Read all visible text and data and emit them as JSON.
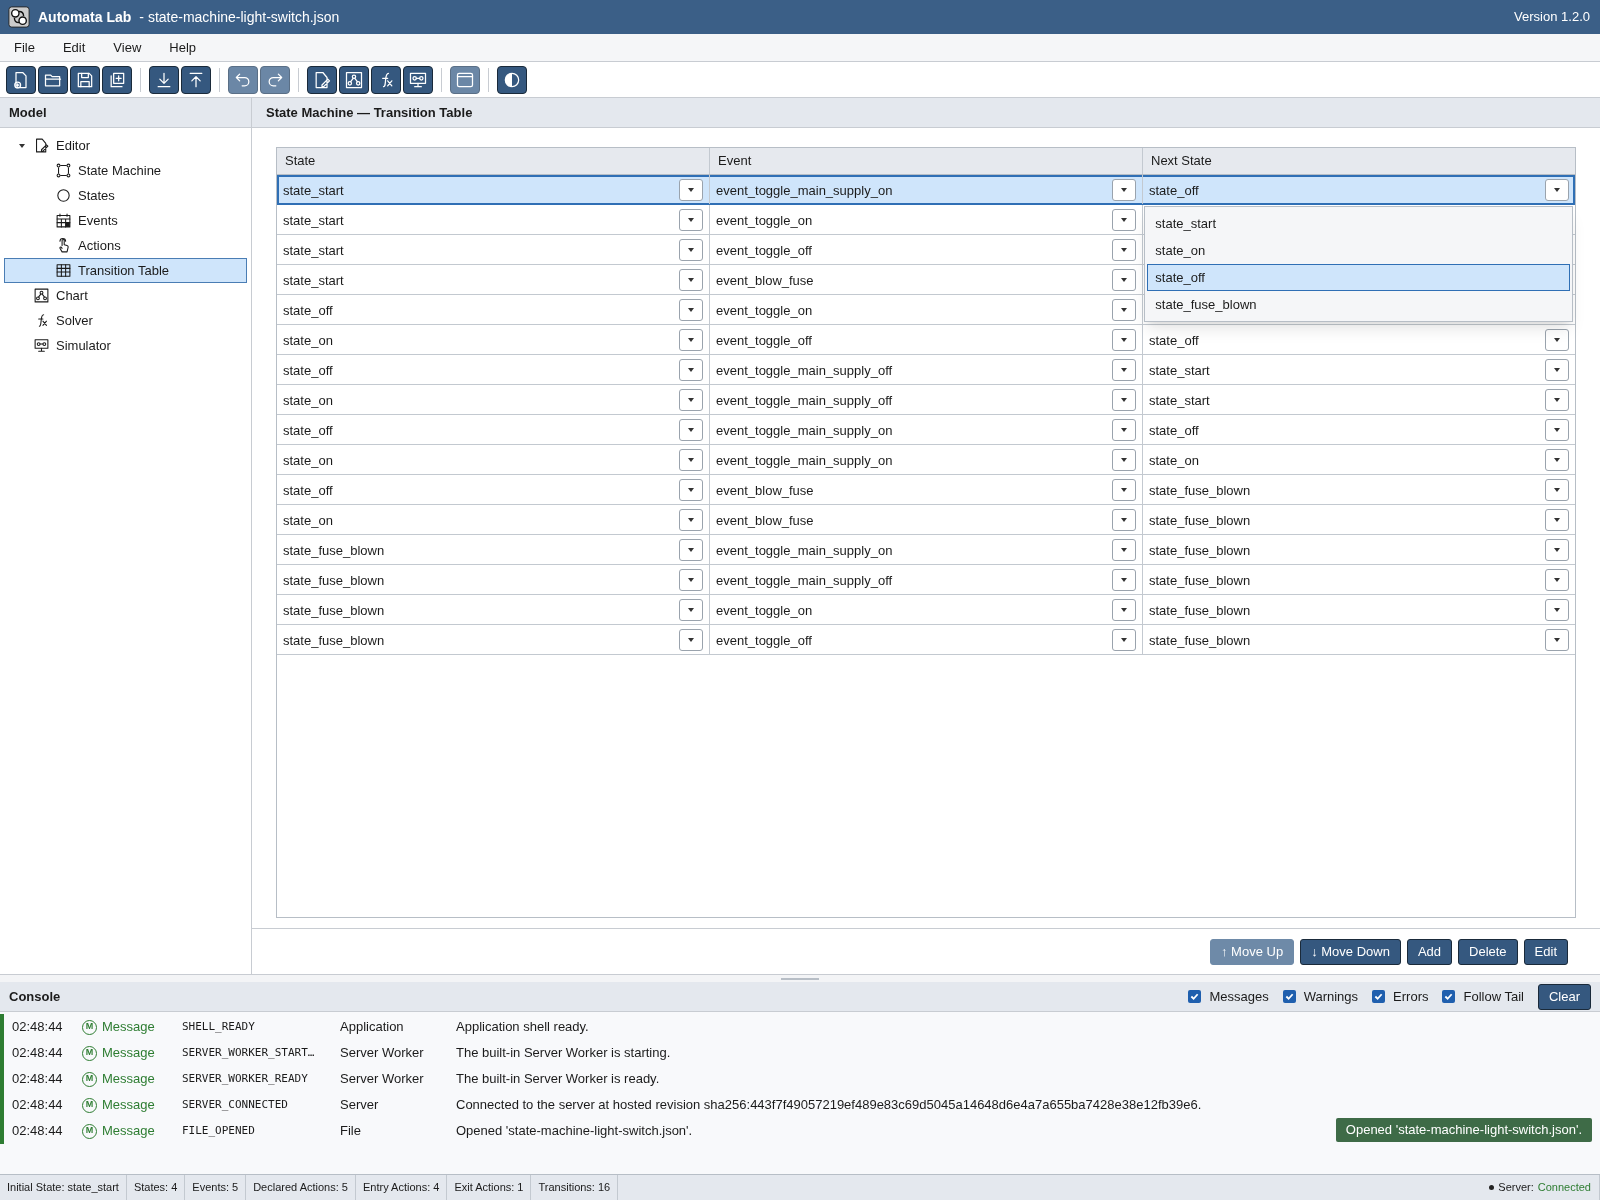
{
  "window": {
    "app_name": "Automata Lab",
    "title": "- state-machine-light-switch.json",
    "version": "Version 1.2.0"
  },
  "menu": [
    "File",
    "Edit",
    "View",
    "Help"
  ],
  "toolbar": [
    [
      {
        "disabled": false
      },
      {
        "disabled": false
      },
      {
        "disabled": false
      },
      {
        "disabled": false
      }
    ],
    [
      {
        "disabled": false
      },
      {
        "disabled": false
      }
    ],
    [
      {
        "disabled": true
      },
      {
        "disabled": true
      }
    ],
    [
      {
        "disabled": false
      },
      {
        "disabled": false
      },
      {
        "disabled": false
      },
      {
        "disabled": false
      }
    ],
    [
      {
        "disabled": true
      }
    ],
    [
      {
        "disabled": false
      }
    ]
  ],
  "sidebar": {
    "title": "Model",
    "items": [
      {
        "label": "Editor",
        "expanded": true,
        "selected": false,
        "children": [
          {
            "label": "State Machine",
            "selected": false
          },
          {
            "label": "States",
            "selected": false
          },
          {
            "label": "Events",
            "selected": false
          },
          {
            "label": "Actions",
            "selected": false
          },
          {
            "label": "Transition Table",
            "selected": true
          }
        ]
      },
      {
        "label": "Chart",
        "selected": false
      },
      {
        "label": "Solver",
        "selected": false
      },
      {
        "label": "Simulator",
        "selected": false
      }
    ]
  },
  "panel_title": "State Machine — Transition Table",
  "table": {
    "columns": [
      "State",
      "Event",
      "Next State"
    ],
    "rows": [
      {
        "state": "state_start",
        "event": "event_toggle_main_supply_on",
        "next_state": "state_off",
        "selected": true
      },
      {
        "state": "state_start",
        "event": "event_toggle_on",
        "selected": false
      },
      {
        "state": "state_start",
        "event": "event_toggle_off",
        "selected": false
      },
      {
        "state": "state_start",
        "event": "event_blow_fuse",
        "selected": false
      },
      {
        "state": "state_off",
        "event": "event_toggle_on",
        "selected": false
      },
      {
        "state": "state_on",
        "event": "event_toggle_off",
        "next_state": "state_off",
        "selected": false
      },
      {
        "state": "state_off",
        "event": "event_toggle_main_supply_off",
        "next_state": "state_start",
        "selected": false
      },
      {
        "state": "state_on",
        "event": "event_toggle_main_supply_off",
        "next_state": "state_start",
        "selected": false
      },
      {
        "state": "state_off",
        "event": "event_toggle_main_supply_on",
        "next_state": "state_off",
        "selected": false
      },
      {
        "state": "state_on",
        "event": "event_toggle_main_supply_on",
        "next_state": "state_on",
        "selected": false
      },
      {
        "state": "state_off",
        "event": "event_blow_fuse",
        "next_state": "state_fuse_blown",
        "selected": false
      },
      {
        "state": "state_on",
        "event": "event_blow_fuse",
        "next_state": "state_fuse_blown",
        "selected": false
      },
      {
        "state": "state_fuse_blown",
        "event": "event_toggle_main_supply_on",
        "next_state": "state_fuse_blown",
        "selected": false
      },
      {
        "state": "state_fuse_blown",
        "event": "event_toggle_main_supply_off",
        "next_state": "state_fuse_blown",
        "selected": false
      },
      {
        "state": "state_fuse_blown",
        "event": "event_toggle_on",
        "next_state": "state_fuse_blown",
        "selected": false
      },
      {
        "state": "state_fuse_blown",
        "event": "event_toggle_off",
        "next_state": "state_fuse_blown",
        "selected": false
      }
    ],
    "dropdown": {
      "options": [
        {
          "label": "state_start",
          "selected": false
        },
        {
          "label": "state_on",
          "selected": false
        },
        {
          "label": "state_off",
          "selected": true
        },
        {
          "label": "state_fuse_blown",
          "selected": false
        }
      ]
    }
  },
  "actions": [
    {
      "label": "↑ Move Up",
      "disabled": true
    },
    {
      "label": "↓ Move Down",
      "disabled": false
    },
    {
      "label": "Add",
      "disabled": false
    },
    {
      "label": "Delete",
      "disabled": false
    },
    {
      "label": "Edit",
      "disabled": false
    }
  ],
  "console": {
    "title": "Console",
    "filters": [
      {
        "label": "Messages",
        "checked": true
      },
      {
        "label": "Warnings",
        "checked": true
      },
      {
        "label": "Errors",
        "checked": true
      },
      {
        "label": "Follow Tail",
        "checked": true
      }
    ],
    "clear_button": "Clear",
    "entries": [
      {
        "time": "02:48:44",
        "kind": "message",
        "badge": "M",
        "level": "Message",
        "code": "SHELL_READY",
        "source": "Application",
        "text": "Application shell ready."
      },
      {
        "time": "02:48:44",
        "kind": "message",
        "badge": "M",
        "level": "Message",
        "code": "SERVER_WORKER_START…",
        "source": "Server Worker",
        "text": "The built-in Server Worker is starting."
      },
      {
        "time": "02:48:44",
        "kind": "message",
        "badge": "M",
        "level": "Message",
        "code": "SERVER_WORKER_READY",
        "source": "Server Worker",
        "text": "The built-in Server Worker is ready."
      },
      {
        "time": "02:48:44",
        "kind": "message",
        "badge": "M",
        "level": "Message",
        "code": "SERVER_CONNECTED",
        "source": "Server",
        "text": "Connected to the server at hosted revision sha256:443f7f49057219ef489e83c69d5045a14648d6e4a7a655ba7428e38e12fb39e6."
      },
      {
        "time": "02:48:44",
        "kind": "message",
        "badge": "M",
        "level": "Message",
        "code": "FILE_OPENED",
        "source": "File",
        "text": "Opened 'state-machine-light-switch.json'."
      }
    ],
    "toast": "Opened 'state-machine-light-switch.json'."
  },
  "status_bar": {
    "items": [
      "Initial State: state_start",
      "States: 4",
      "Events: 5",
      "Declared Actions: 5",
      "Entry Actions: 4",
      "Exit Actions: 1",
      "Transitions: 16"
    ],
    "server_label": "Server:",
    "server_status": "Connected"
  }
}
